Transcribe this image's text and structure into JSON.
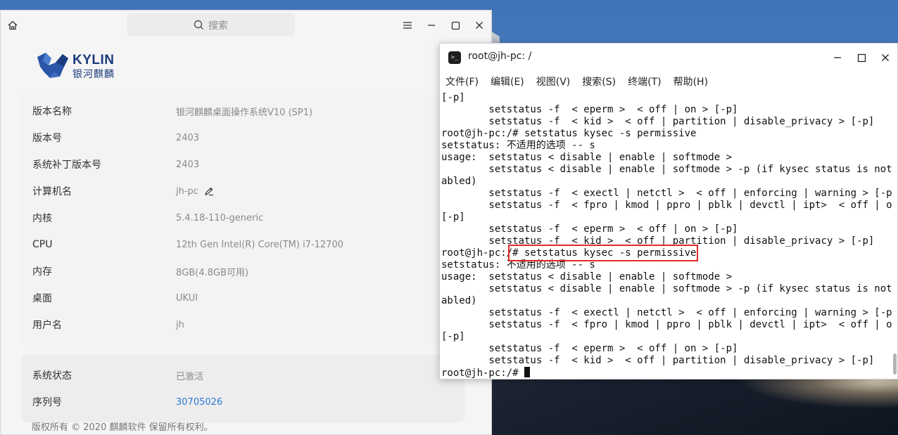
{
  "settings": {
    "search_placeholder": "搜索",
    "logo": {
      "brand": "KYLIN",
      "subtitle": "银河麒麟"
    },
    "info_rows": [
      {
        "label": "版本名称",
        "value": "银河麒麟桌面操作系统V10 (SP1)"
      },
      {
        "label": "版本号",
        "value": "2403"
      },
      {
        "label": "系统补丁版本号",
        "value": "2403"
      },
      {
        "label": "计算机名",
        "value": "jh-pc"
      },
      {
        "label": "内核",
        "value": "5.4.18-110-generic"
      },
      {
        "label": "CPU",
        "value": "12th Gen Intel(R) Core(TM) i7-12700"
      },
      {
        "label": "内存",
        "value": "8GB(4.8GB可用)"
      },
      {
        "label": "桌面",
        "value": "UKUI"
      },
      {
        "label": "用户名",
        "value": "jh"
      }
    ],
    "status_rows": [
      {
        "label": "系统状态",
        "value": "已激活"
      },
      {
        "label": "序列号",
        "value": "30705026"
      }
    ],
    "footer": "版权所有 © 2020 麒麟软件 保留所有权利。"
  },
  "terminal": {
    "title": "root@jh-pc: /",
    "menu": [
      "文件(F)",
      "编辑(E)",
      "视图(V)",
      "搜索(S)",
      "终端(T)",
      "帮助(H)"
    ],
    "lines": [
      "[-p]",
      "        setstatus -f  < eperm >  < off | on > [-p]",
      "        setstatus -f  < kid >  < off | partition | disable_privacy > [-p]",
      "root@jh-pc:/# setstatus kysec -s permissive",
      "setstatus: 不适用的选项 -- s",
      "usage:  setstatus < disable | enable | softmode >",
      "        setstatus < disable | enable | softmode > -p (if kysec status is not dis",
      "abled)",
      "        setstatus -f  < exectl | netctl >  < off | enforcing | warning > [-p]",
      "        setstatus -f  < fpro | kmod | ppro | pblk | devctl | ipt>  < off | on >",
      "[-p]",
      "        setstatus -f  < eperm >  < off | on > [-p]",
      "        setstatus -f  < kid >  < off | partition | disable_privacy > [-p]",
      "root@jh-pc:/# setstatus kysec -s permissive",
      "setstatus: 不适用的选项 -- s",
      "usage:  setstatus < disable | enable | softmode >",
      "        setstatus < disable | enable | softmode > -p (if kysec status is not dis",
      "abled)",
      "        setstatus -f  < exectl | netctl >  < off | enforcing | warning > [-p]",
      "        setstatus -f  < fpro | kmod | ppro | pblk | devctl | ipt>  < off | on >",
      "[-p]",
      "        setstatus -f  < eperm >  < off | on > [-p]",
      "        setstatus -f  < kid >  < off | partition | disable_privacy > [-p]"
    ],
    "prompt": "root@jh-pc:/# "
  },
  "colors": {
    "accent_link": "#2a7ad8",
    "highlight": "#e02a2a"
  }
}
